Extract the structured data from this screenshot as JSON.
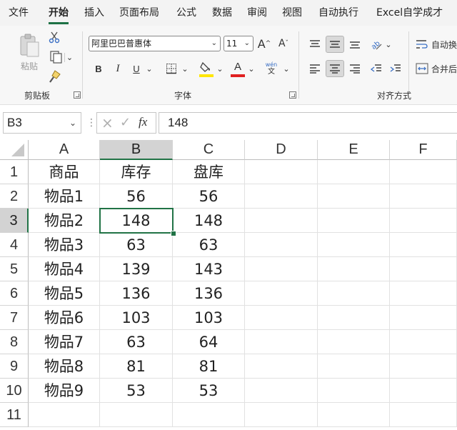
{
  "menu": {
    "tabs": [
      "文件",
      "开始",
      "插入",
      "页面布局",
      "公式",
      "数据",
      "审阅",
      "视图",
      "自动执行",
      "Excel自学成才"
    ],
    "active": "开始"
  },
  "ribbon": {
    "clipboard": {
      "paste_label": "粘贴",
      "group_label": "剪贴板"
    },
    "font": {
      "font_name": "阿里巴巴普惠体",
      "font_size": "11",
      "bold": "B",
      "italic": "I",
      "underline": "U",
      "grow": "A",
      "shrink": "A",
      "phonetic_top": "wén",
      "phonetic_bottom": "文",
      "group_label": "字体",
      "fill_color": "#ffe600",
      "font_color": "#e02020"
    },
    "alignment": {
      "wrap_label": "自动换",
      "merge_label": "合并后",
      "group_label": "对齐方式"
    }
  },
  "formula_bar": {
    "name_box": "B3",
    "cancel_icon": "×",
    "enter_icon": "✓",
    "fx_label": "fx",
    "value": "148"
  },
  "sheet": {
    "columns": [
      "A",
      "B",
      "C",
      "D",
      "E",
      "F"
    ],
    "rows": [
      "1",
      "2",
      "3",
      "4",
      "5",
      "6",
      "7",
      "8",
      "9",
      "10",
      "11"
    ],
    "selected_cell": "B3",
    "cells": [
      [
        "商品",
        "库存",
        "盘库"
      ],
      [
        "物品1",
        "56",
        "56"
      ],
      [
        "物品2",
        "148",
        "148"
      ],
      [
        "物品3",
        "63",
        "63"
      ],
      [
        "物品4",
        "139",
        "143"
      ],
      [
        "物品5",
        "136",
        "136"
      ],
      [
        "物品6",
        "103",
        "103"
      ],
      [
        "物品7",
        "63",
        "64"
      ],
      [
        "物品8",
        "81",
        "81"
      ],
      [
        "物品9",
        "53",
        "53"
      ],
      [
        "",
        "",
        ""
      ]
    ],
    "accent_color": "#217346"
  }
}
